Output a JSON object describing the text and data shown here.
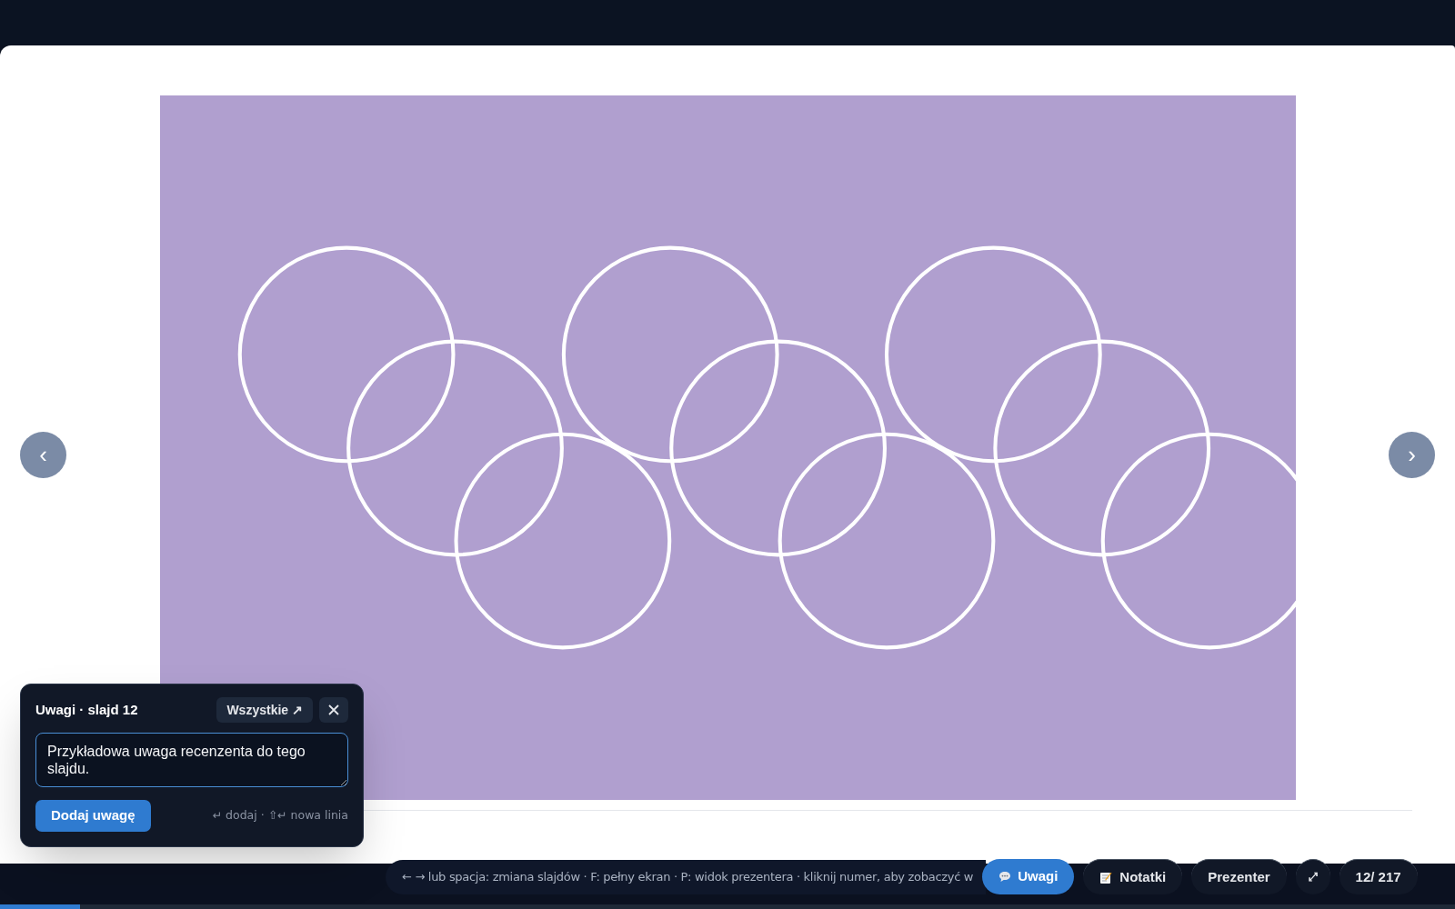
{
  "nav": {
    "prev": "‹",
    "next": "›"
  },
  "notes_panel": {
    "title": "Uwagi · slajd **12**",
    "all_button": "Wszystkie ↗",
    "note_value": "Przykładowa uwaga recenzenta do tego slajdu.",
    "add_button": "Dodaj uwagę",
    "shortcut_hint": "↵ dodaj · ⇧↵ nowa linia"
  },
  "toolbar": {
    "hint": "← → lub spacja: zmiana slajdów · F: pełny ekran · P: widok prezentera · kliknij numer, aby zobaczyć w",
    "buttons": [
      {
        "kind": "comments",
        "label": "Uwagi",
        "selected": true
      },
      {
        "kind": "notes",
        "label": "Notatki",
        "selected": false
      },
      {
        "kind": "presenter",
        "label": "Prezenter",
        "selected": false
      },
      {
        "kind": "fullscreen",
        "label": "⤢",
        "selected": false
      },
      {
        "kind": "counter",
        "label": "12/ 217",
        "selected": false
      }
    ]
  },
  "progress": {
    "level": 0.055
  }
}
